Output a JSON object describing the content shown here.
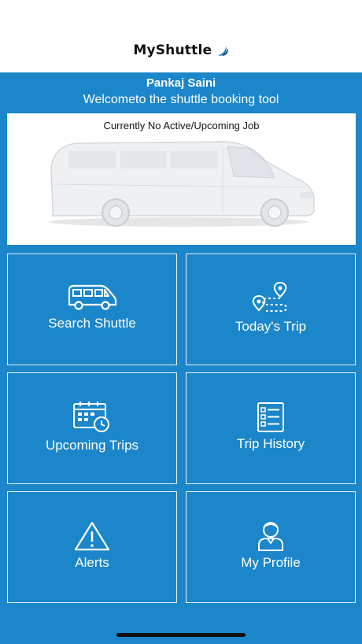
{
  "header": {
    "brand": "MyShuttle"
  },
  "user": {
    "name": "Pankaj Saini",
    "welcome": "Welcometo the shuttle booking tool"
  },
  "job_card": {
    "status": "Currently No Active/Upcoming Job"
  },
  "menu": {
    "search_shuttle": "Search Shuttle",
    "todays_trip": "Today's Trip",
    "upcoming_trips": "Upcoming Trips",
    "trip_history": "Trip History",
    "alerts": "Alerts",
    "my_profile": "My Profile"
  },
  "colors": {
    "primary": "#1b86c9",
    "tile_border": "#e6f2fa",
    "card": "#ffffff"
  }
}
